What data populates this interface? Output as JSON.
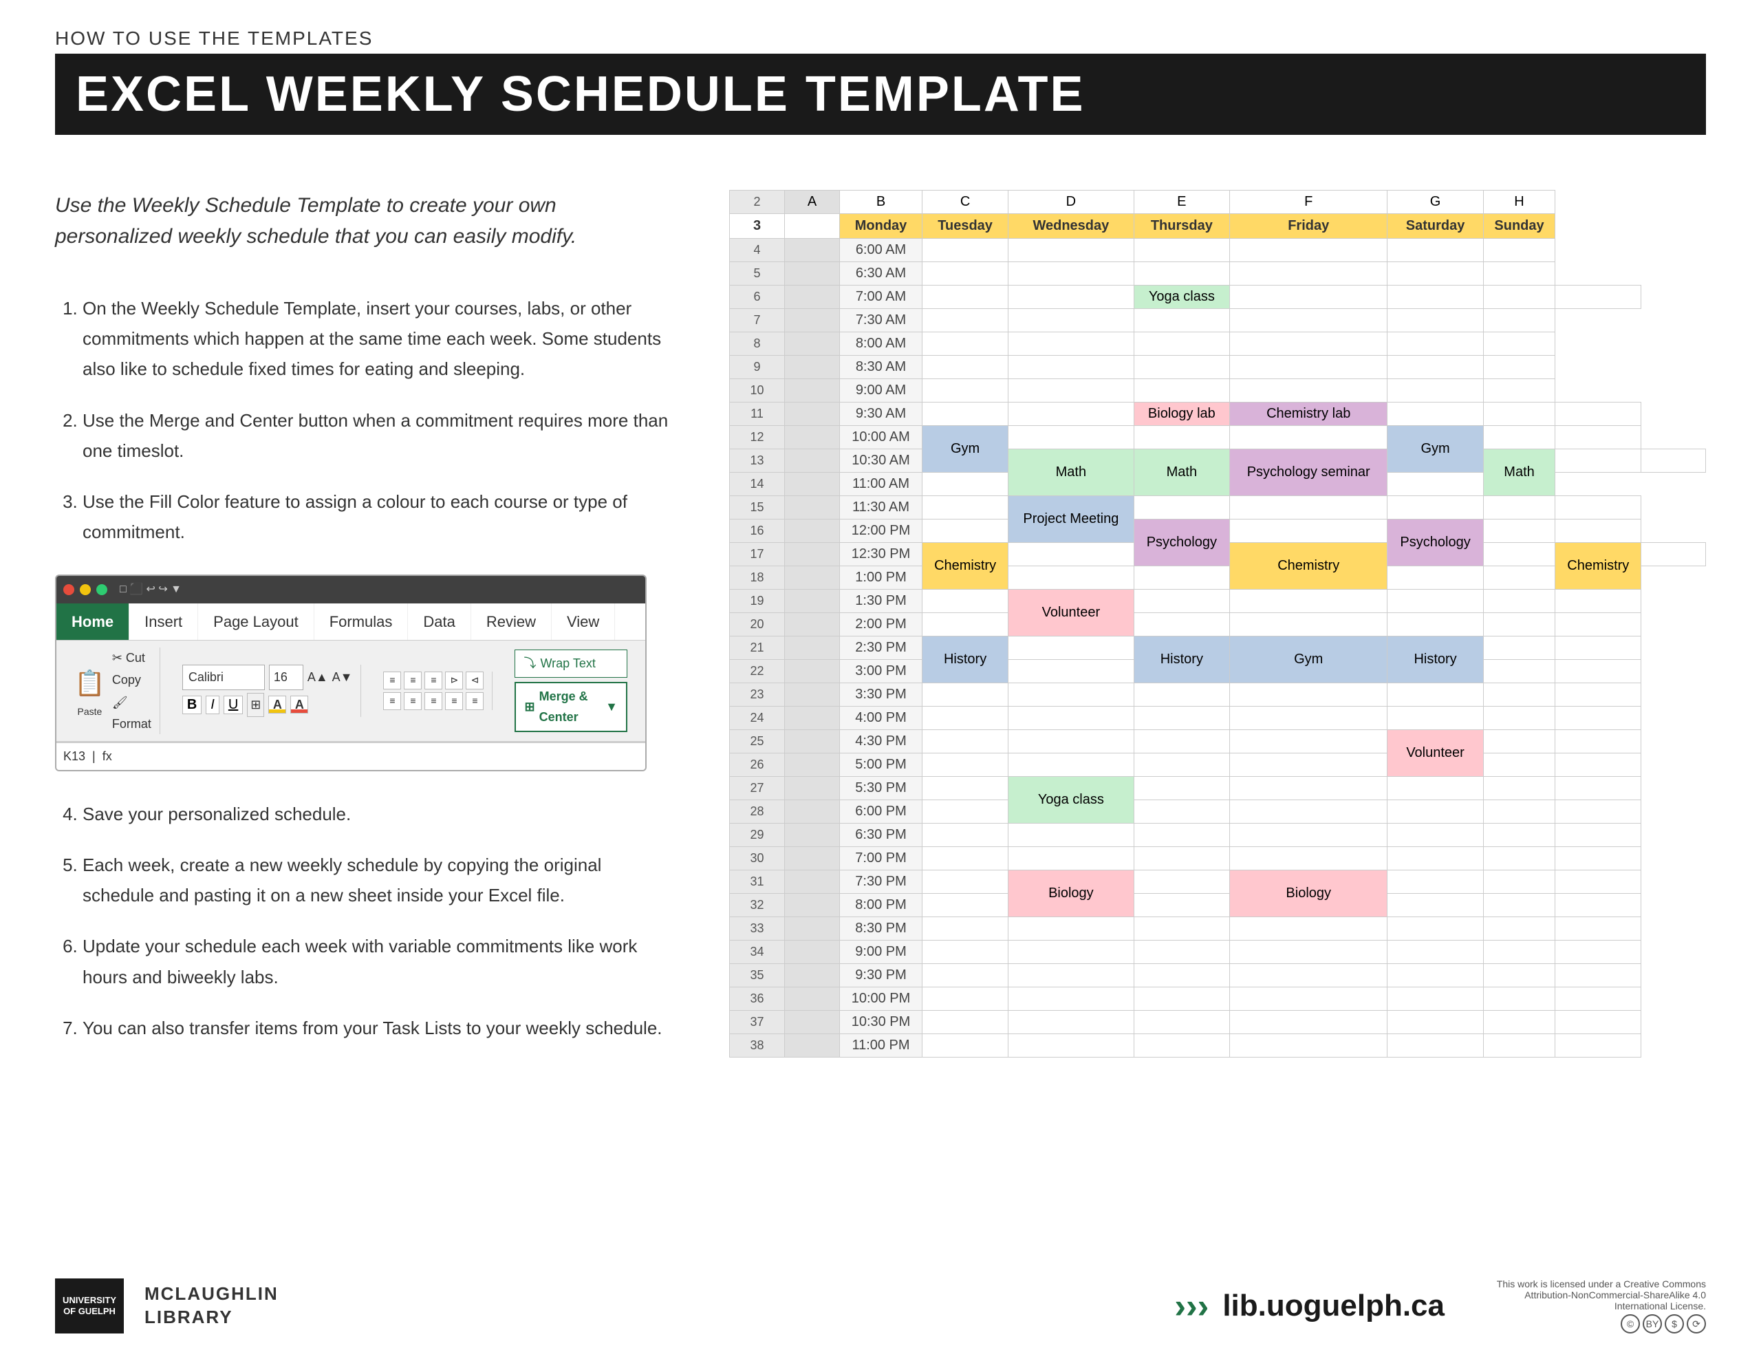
{
  "header": {
    "subtitle": "HOW TO USE THE TEMPLATES",
    "title": "EXCEL WEEKLY SCHEDULE TEMPLATE"
  },
  "intro": {
    "text": "Use the Weekly Schedule Template to create your own personalized weekly schedule that you can easily modify."
  },
  "instructions": {
    "items": [
      "On the Weekly Schedule Template, insert your courses, labs, or other commitments which happen at the same time each week.  Some students also like to schedule fixed times for eating and sleeping.",
      "Use the Merge and Center button when a commitment requires more than one timeslot.",
      "Use the Fill Color feature to assign a colour to each course or type of commitment.",
      "Save your personalized schedule.",
      "Each week, create a new weekly schedule by copying the original schedule and pasting it on a new sheet inside your Excel file.",
      "Update your schedule each week with variable commitments like work hours and biweekly labs.",
      "You can also transfer items from your Task Lists to your weekly schedule."
    ]
  },
  "excel_mock": {
    "ribbon_tabs": [
      "Home",
      "Insert",
      "Page Layout",
      "Formulas",
      "Data",
      "Review",
      "View"
    ],
    "active_tab": "Home",
    "font_name": "Calibri",
    "font_size": "16",
    "paste_label": "Paste",
    "cut_label": "Cut",
    "copy_label": "Copy",
    "format_label": "Format",
    "wrap_text_label": "Wrap Text",
    "merge_center_label": "Merge & Center",
    "formula_cell": "K13",
    "formula_bar_label": "fx"
  },
  "schedule": {
    "days": [
      "Monday",
      "Tuesday",
      "Wednesday",
      "Thursday",
      "Friday",
      "Saturday",
      "Sunday"
    ],
    "col_letters": [
      "A",
      "B",
      "C",
      "D",
      "E",
      "F",
      "G",
      "H"
    ],
    "rows": [
      {
        "row": 2,
        "time": ""
      },
      {
        "row": 3,
        "time": ""
      },
      {
        "row": 4,
        "time": "6:00 AM",
        "mon": "",
        "tue": "",
        "wed": "",
        "thu": "",
        "fri": "",
        "sat": "",
        "sun": ""
      },
      {
        "row": 5,
        "time": "6:30 AM"
      },
      {
        "row": 6,
        "time": "7:00 AM",
        "wed": "Yoga class"
      },
      {
        "row": 7,
        "time": "7:30 AM"
      },
      {
        "row": 8,
        "time": "8:00 AM"
      },
      {
        "row": 9,
        "time": "8:30 AM"
      },
      {
        "row": 10,
        "time": "9:00 AM"
      },
      {
        "row": 11,
        "time": "9:30 AM",
        "wed": "Biology lab",
        "thu": "Chemistry lab"
      },
      {
        "row": 12,
        "time": "10:00 AM",
        "mon": "Gym",
        "fri": "Gym"
      },
      {
        "row": 13,
        "time": "10:30 AM",
        "mon": "Math",
        "wed": "Math",
        "thu": "Psychology seminar",
        "fri": "Math"
      },
      {
        "row": 14,
        "time": "11:00 AM"
      },
      {
        "row": 15,
        "time": "11:30 AM",
        "tue": "Project Meeting"
      },
      {
        "row": 16,
        "time": "12:00 PM",
        "tue": "Psychology",
        "thu": "Psychology"
      },
      {
        "row": 17,
        "time": "12:30 PM",
        "mon": "Chemistry",
        "wed": "Chemistry",
        "fri": "Chemistry"
      },
      {
        "row": 18,
        "time": "1:00 PM"
      },
      {
        "row": 19,
        "time": "1:30 PM",
        "tue": "Volunteer"
      },
      {
        "row": 20,
        "time": "2:00 PM"
      },
      {
        "row": 21,
        "time": "2:30 PM",
        "mon": "History",
        "wed": "History",
        "thu": "Gym",
        "fri": "History"
      },
      {
        "row": 22,
        "time": "3:00 PM"
      },
      {
        "row": 23,
        "time": "3:30 PM"
      },
      {
        "row": 24,
        "time": "4:00 PM"
      },
      {
        "row": 25,
        "time": "4:30 PM",
        "fri": "Volunteer"
      },
      {
        "row": 26,
        "time": "5:00 PM"
      },
      {
        "row": 27,
        "time": "5:30 PM",
        "tue": "Yoga class"
      },
      {
        "row": 28,
        "time": "6:00 PM"
      },
      {
        "row": 29,
        "time": "6:30 PM"
      },
      {
        "row": 30,
        "time": "7:00 PM"
      },
      {
        "row": 31,
        "time": "7:30 PM",
        "tue": "Biology",
        "thu": "Biology"
      },
      {
        "row": 32,
        "time": "8:00 PM"
      },
      {
        "row": 33,
        "time": "8:30 PM"
      },
      {
        "row": 34,
        "time": "9:00 PM"
      },
      {
        "row": 35,
        "time": "9:30 PM"
      },
      {
        "row": 36,
        "time": "10:00 PM"
      },
      {
        "row": 37,
        "time": "10:30 PM"
      },
      {
        "row": 38,
        "time": "11:00 PM"
      }
    ]
  },
  "footer": {
    "university": "UNIVERSITY\nOF GUELPH",
    "library_line1": "McLaughlin",
    "library_line2": "Library",
    "url": "lib.uoguelph.ca",
    "cc_text": "This work is licensed under a Creative Commons Attribution-NonCommercial-ShareAlike 4.0 International License."
  }
}
